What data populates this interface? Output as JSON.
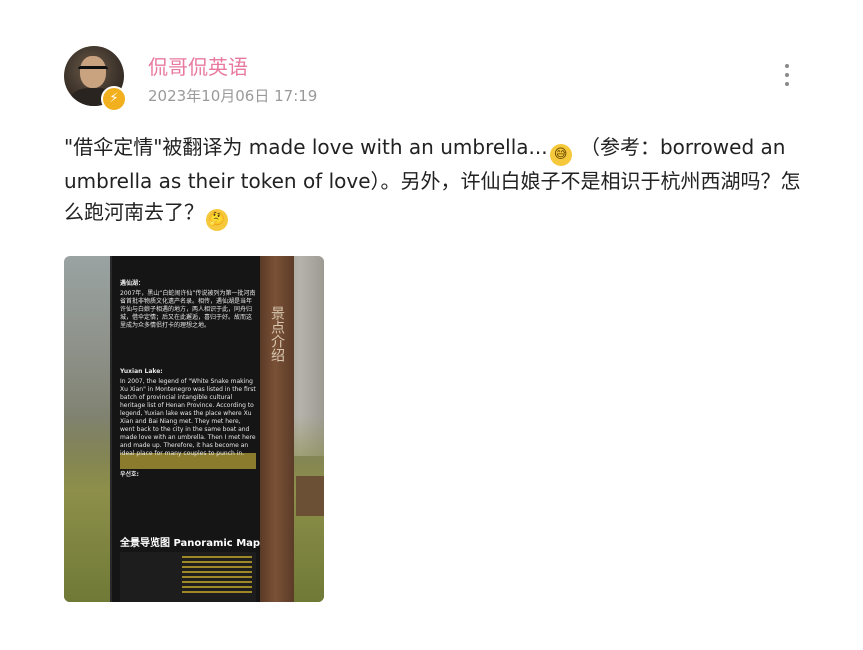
{
  "user": {
    "name": "侃哥侃英语",
    "time": "2023年10月06日 17:19",
    "badge_icon": "lightning-badge-icon"
  },
  "post": {
    "line1_a": "\"借伞定情\"被翻译为 made love with an umbrella...",
    "line1_b": " （参考：borrowed an umbrella as their token of love）。另外，许仙白娘子不是相识于杭州西湖吗？怎么跑河南去了？",
    "emoji1": "sweat-smile-emoji-icon",
    "emoji2": "thinking-emoji-icon"
  },
  "photo": {
    "sign_cn_title": "遇仙湖：",
    "sign_cn_body": "2007年，黑山“白蛇闹许仙”传说被列为第一批河南省首批非物质文化遗产名录。相传，遇仙湖是当年许仙与白娘子相遇的地方，两人相识于此，同舟归城，借伞定情；后又在此邂逅，喜归于好。故而这里成为众多情侣打卡的理想之地。",
    "sign_en_title": "Yuxian Lake:",
    "sign_en_body": "In 2007, the legend of \"White Snake making Xu Xian\" in Montenegro was listed in the first batch of provincial intangible cultural heritage list of Henan Province. According to legend, Yuxian lake was the place where Xu Xian and Bai Niang met. They met here, went back to the city in the same boat and made love with an umbrella. Then I met here and made up. Therefore, it has become an ideal place for many couples to punch in.",
    "sign_kr_title": "우선호:",
    "map_title": "全景导览图 Panoramic Map",
    "post_text": "景点介绍"
  }
}
